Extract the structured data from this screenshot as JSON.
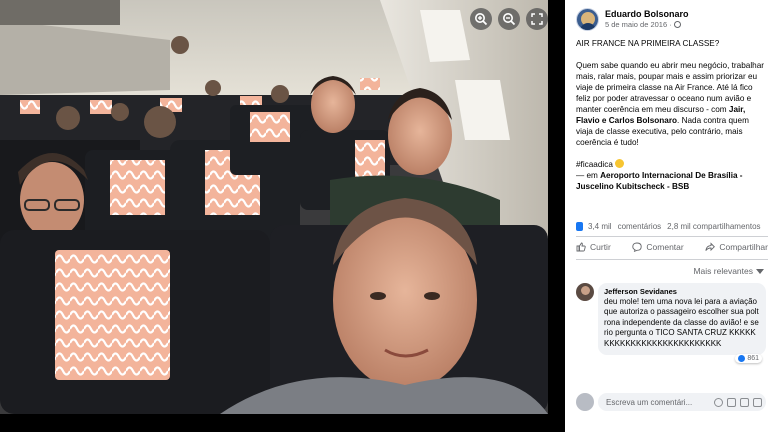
{
  "post": {
    "author": "Eduardo Bolsonaro",
    "date": "5 de maio de 2016 ·",
    "paragraphs": {
      "headline": "AIR FRANCE NA PRIMEIRA CLASSE?",
      "body_part1": "Quem sabe quando eu abrir meu negócio, trabalhar mais, ralar mais, poupar mais e assim priorizar eu viaje de primeira classe na Air France. Até lá fico feliz por poder atravessar o oceano num avião e manter coerência em meu discurso - com ",
      "body_names": "Jair, Flavio e Carlos Bolsonaro",
      "body_part2": ". Nada contra quem viaja de classe executiva, pelo contrário, mais coerência é tudo!",
      "hashtag": "#ficaadica",
      "location_prefix": "— em ",
      "location_name": "Aeroporto Internacional De Brasília - Juscelino Kubitscheck - BSB"
    },
    "stats": {
      "reactions": "3,4 mil",
      "comments": "comentários",
      "shares": "2,8 mil compartilhamentos"
    },
    "actions": {
      "like": "Curtir",
      "comment": "Comentar",
      "share": "Compartilhar"
    },
    "sort_label": "Mais relevantes"
  },
  "comment": {
    "author": "Jefferson Sevidanes",
    "text": "deu mole! tem uma nova lei para a aviação que autoriza o passageiro escolher sua poltrona independente da classe do avião! e serio pergunta o TICO SANTA CRUZ KKKKKKKKKKKKKKKKKKKKKKKKKKK",
    "reactions": "861"
  },
  "composer": {
    "placeholder": "Escreva um comentári..."
  },
  "viewer": {
    "controls": [
      "zoom-in-icon",
      "zoom-out-icon",
      "fullscreen-icon"
    ]
  },
  "colors": {
    "seat_fabric": "#1c1e22",
    "headrest_cover": "#f1a487",
    "cabin_wall": "#d7d2c6",
    "accent": "#1877f2"
  }
}
